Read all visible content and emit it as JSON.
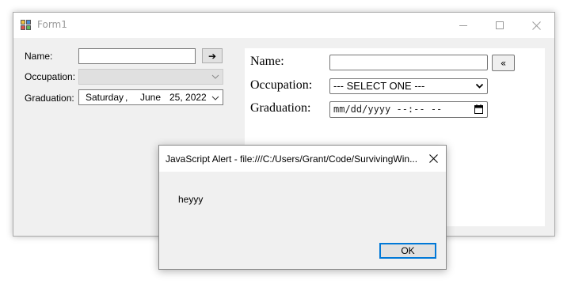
{
  "window": {
    "title": "Form1",
    "icon": "winforms-app-icon",
    "controls": {
      "minimize": "minimize-icon",
      "maximize": "maximize-icon",
      "close": "close-icon"
    }
  },
  "winform": {
    "name_label": "Name:",
    "name_value": "",
    "arrow_button": "➔",
    "occupation_label": "Occupation:",
    "occupation_value": "",
    "graduation_label": "Graduation:",
    "date": {
      "day": "Saturday",
      "sep": ",",
      "month": "June",
      "dayyear": "25, 2022"
    }
  },
  "web": {
    "name_label": "Name:",
    "name_value": "",
    "back_button": "«",
    "occupation_label": "Occupation:",
    "occupation_value": "--- SELECT ONE ---",
    "graduation_label": "Graduation:",
    "graduation_placeholder": "mm/dd/yyyy --:-- --"
  },
  "alert": {
    "title": "JavaScript Alert - file:///C:/Users/Grant/Code/SurvivingWin...",
    "message": "heyyy",
    "ok_label": "OK"
  },
  "colors": {
    "form_background": "#f0f0f0",
    "ok_border": "#0078d7"
  }
}
